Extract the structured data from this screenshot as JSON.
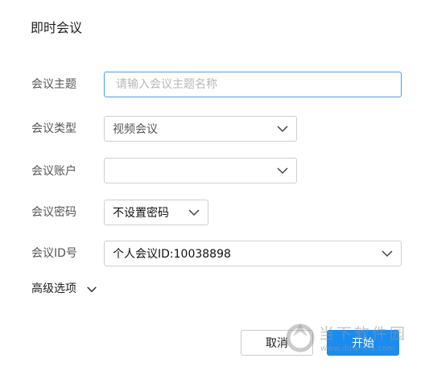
{
  "dialog": {
    "title": "即时会议"
  },
  "form": {
    "topic": {
      "label": "会议主题",
      "placeholder": "请输入会议主题名称",
      "value": ""
    },
    "type": {
      "label": "会议类型",
      "selected": "视频会议"
    },
    "account": {
      "label": "会议账户",
      "selected": ""
    },
    "password": {
      "label": "会议密码",
      "selected": "不设置密码"
    },
    "meeting_id": {
      "label": "会议ID号",
      "selected": "个人会议ID:10038898"
    }
  },
  "advanced": {
    "label": "高级选项"
  },
  "buttons": {
    "cancel": "取消",
    "start": "开始"
  },
  "watermark": {
    "text": "当下软件园",
    "url": "www.downxia.com"
  },
  "colors": {
    "accent": "#1a8cf0",
    "focus_border": "#4a9ef5"
  },
  "icons": {
    "select_arrow": "chevron-down-icon",
    "advanced_arrow": "chevron-down-icon"
  }
}
